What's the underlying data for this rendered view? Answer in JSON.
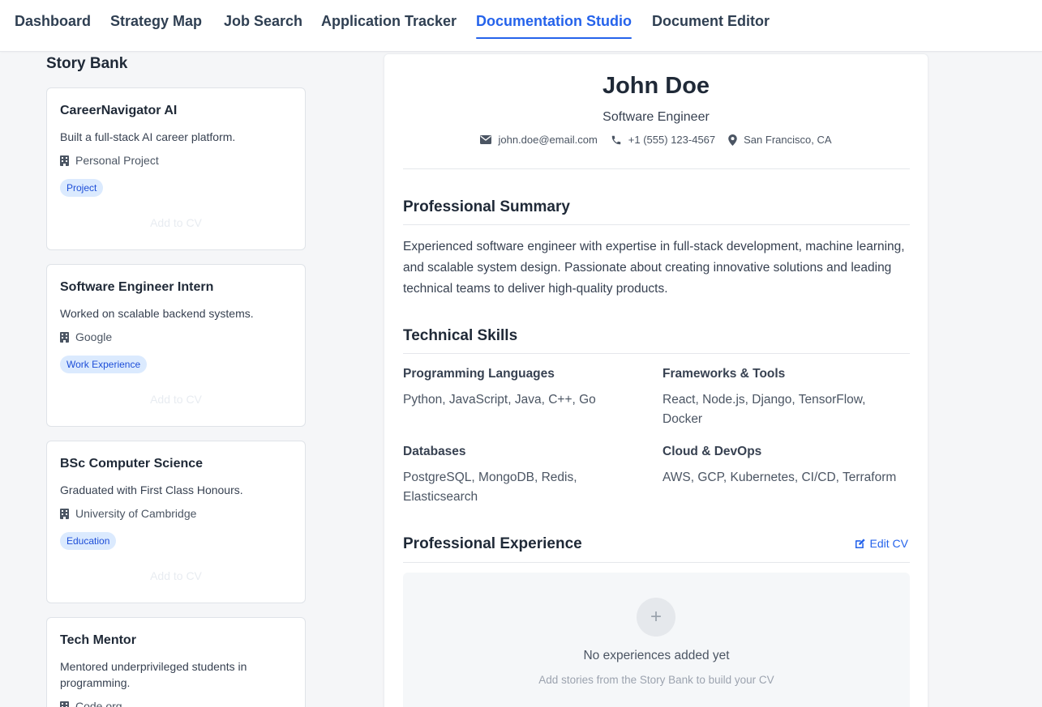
{
  "nav": {
    "tabs": [
      {
        "label": "Dashboard"
      },
      {
        "label": "Strategy Map"
      },
      {
        "label": "Job Search"
      },
      {
        "label": "Application Tracker"
      },
      {
        "label": "Documentation Studio"
      },
      {
        "label": "Document Editor"
      }
    ],
    "active": "Documentation Studio"
  },
  "story_bank": {
    "title": "Story Bank",
    "add_label": "Add to CV",
    "stories": [
      {
        "title": "CareerNavigator AI",
        "description": "Built a full-stack AI career platform.",
        "org": "Personal Project",
        "tag": "Project"
      },
      {
        "title": "Software Engineer Intern",
        "description": "Worked on scalable backend systems.",
        "org": "Google",
        "tag": "Work Experience"
      },
      {
        "title": "BSc Computer Science",
        "description": "Graduated with First Class Honours.",
        "org": "University of Cambridge",
        "tag": "Education"
      },
      {
        "title": "Tech Mentor",
        "description": "Mentored underprivileged students in programming.",
        "org": "Code.org",
        "tag": ""
      }
    ]
  },
  "cv": {
    "name": "John Doe",
    "role": "Software Engineer",
    "email": "john.doe@email.com",
    "phone": "+1 (555) 123-4567",
    "location": "San Francisco, CA",
    "summary_title": "Professional Summary",
    "summary": "Experienced software engineer with expertise in full-stack development, machine learning, and scalable system design. Passionate about creating innovative solutions and leading technical teams to deliver high-quality products.",
    "skills_title": "Technical Skills",
    "skills": [
      {
        "heading": "Programming Languages",
        "value": "Python, JavaScript, Java, C++, Go"
      },
      {
        "heading": "Frameworks & Tools",
        "value": "React, Node.js, Django, TensorFlow, Docker"
      },
      {
        "heading": "Databases",
        "value": "PostgreSQL, MongoDB, Redis, Elasticsearch"
      },
      {
        "heading": "Cloud & DevOps",
        "value": "AWS, GCP, Kubernetes, CI/CD, Terraform"
      }
    ],
    "experience_title": "Professional Experience",
    "edit_label": "Edit CV",
    "empty_main": "No experiences added yet",
    "empty_sub": "Add stories from the Story Bank to build your CV"
  },
  "colors": {
    "accent": "#2563eb",
    "tag_bg": "#dbeafe",
    "tag_text": "#1d4ed8"
  }
}
